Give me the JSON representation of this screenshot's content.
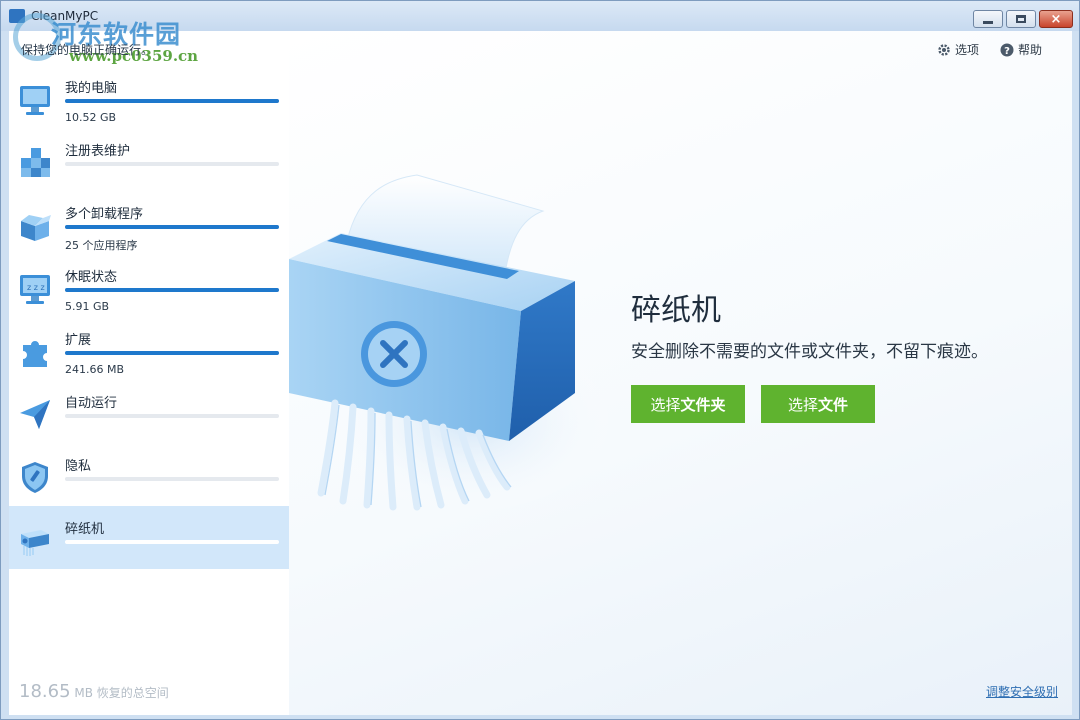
{
  "window": {
    "title": "CleanMyPC",
    "subtitle": "保持您的电脑正确运行。",
    "controls": {
      "minimize": "minimize",
      "maximize": "maximize",
      "close": "×"
    }
  },
  "watermark": {
    "main": "河东软件园",
    "url": "www.pc0359.cn"
  },
  "header": {
    "options_label": "选项",
    "help_label": "帮助"
  },
  "sidebar": {
    "items": [
      {
        "label": "我的电脑",
        "detail": "10.52 GB",
        "progress": 1.0,
        "icon": "monitor-icon"
      },
      {
        "label": "注册表维护",
        "detail": "",
        "progress": 0,
        "icon": "registry-cubes-icon"
      },
      {
        "label": "多个卸载程序",
        "detail": "25 个应用程序",
        "progress": 1.0,
        "icon": "open-box-icon"
      },
      {
        "label": "休眠状态",
        "detail": "5.91 GB",
        "progress": 1.0,
        "icon": "sleep-monitor-icon"
      },
      {
        "label": "扩展",
        "detail": "241.66 MB",
        "progress": 1.0,
        "icon": "puzzle-icon"
      },
      {
        "label": "自动运行",
        "detail": "",
        "progress": 0,
        "icon": "paper-plane-icon"
      },
      {
        "label": "隐私",
        "detail": "",
        "progress": 0,
        "icon": "shield-brush-icon"
      },
      {
        "label": "碎纸机",
        "detail": "",
        "progress": 0,
        "icon": "shredder-icon",
        "active": true
      }
    ],
    "total_value": "18.65",
    "total_unit": "MB 恢复的总空间"
  },
  "main": {
    "title": "碎纸机",
    "description": "安全删除不需要的文件或文件夹，不留下痕迹。",
    "button_folder_prefix": "选择",
    "button_folder_strong": "文件夹",
    "button_file_prefix": "选择",
    "button_file_strong": "文件",
    "adjust_link": "调整安全级别"
  },
  "colors": {
    "accent": "#1e78cc",
    "button_green": "#5fb32f",
    "active_item": "#d2e7fa"
  }
}
